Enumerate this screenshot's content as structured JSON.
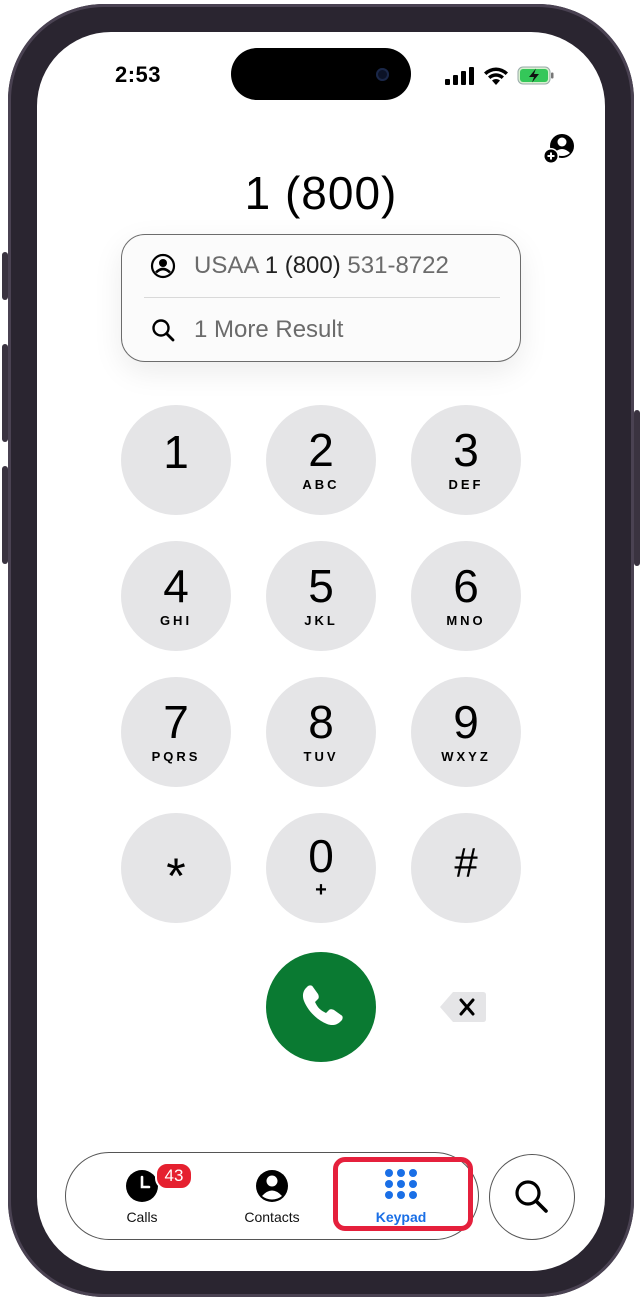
{
  "status_bar": {
    "time": "2:53",
    "signal_icon": "cellular-signal-icon",
    "wifi_icon": "wifi-icon",
    "battery_icon": "battery-charging-icon"
  },
  "dial": {
    "number": "1 (800)"
  },
  "suggestions": {
    "contact": {
      "name": "USAA",
      "match": "1 (800)",
      "rest": "531-8722"
    },
    "more": "1 More Result"
  },
  "keypad": {
    "keys": [
      {
        "digit": "1",
        "letters": ""
      },
      {
        "digit": "2",
        "letters": "ABC"
      },
      {
        "digit": "3",
        "letters": "DEF"
      },
      {
        "digit": "4",
        "letters": "GHI"
      },
      {
        "digit": "5",
        "letters": "JKL"
      },
      {
        "digit": "6",
        "letters": "MNO"
      },
      {
        "digit": "7",
        "letters": "PQRS"
      },
      {
        "digit": "8",
        "letters": "TUV"
      },
      {
        "digit": "9",
        "letters": "WXYZ"
      },
      {
        "digit": "*",
        "letters": ""
      },
      {
        "digit": "0",
        "letters": "+"
      },
      {
        "digit": "#",
        "letters": ""
      }
    ]
  },
  "tabs": {
    "calls": {
      "label": "Calls",
      "badge": "43"
    },
    "contacts": {
      "label": "Contacts"
    },
    "keypad": {
      "label": "Keypad"
    }
  },
  "colors": {
    "accent": "#1a6fe6",
    "call_green": "#0a7a32",
    "highlight_red": "#e5203c",
    "badge_red": "#e5202f"
  }
}
